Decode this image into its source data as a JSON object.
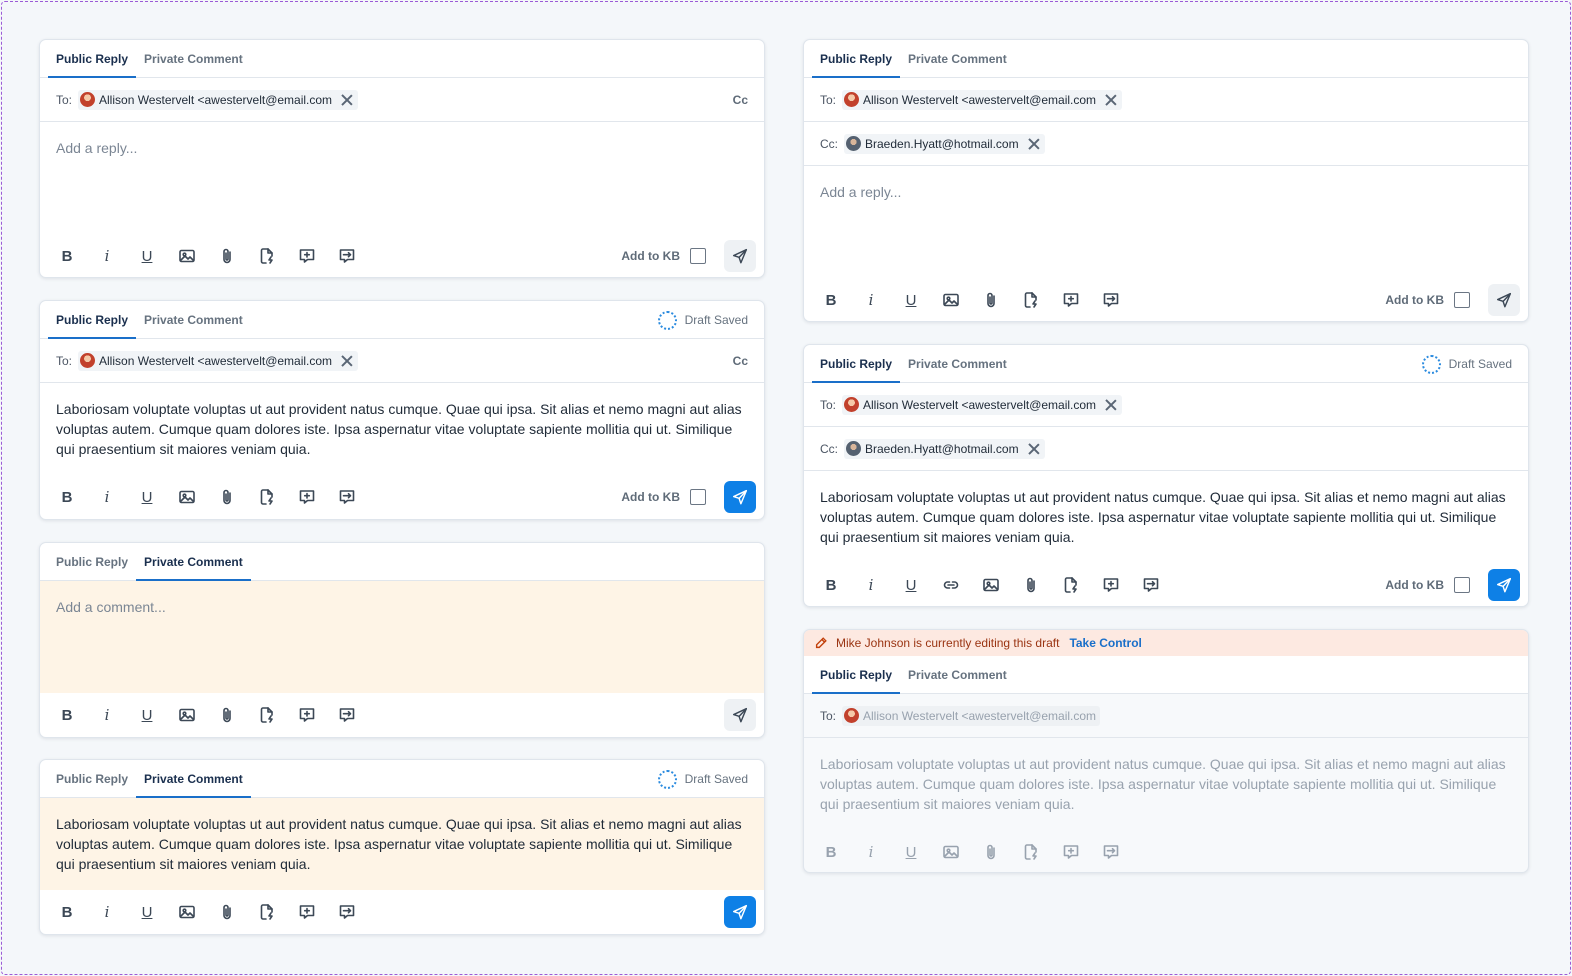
{
  "tabs": {
    "public": "Public Reply",
    "private": "Private Comment"
  },
  "draft_saved": "Draft Saved",
  "to_label": "To:",
  "cc_label": "Cc:",
  "cc_button": "Cc",
  "to_recipient": "Allison Westervelt <awestervelt@email.com",
  "cc_recipient": "Braeden.Hyatt@hotmail.com",
  "reply_placeholder": "Add a reply...",
  "comment_placeholder": "Add a comment...",
  "message_text": "Laboriosam voluptate voluptas ut aut provident natus cumque. Quae qui ipsa. Sit alias et nemo magni aut alias voluptas autem. Cumque quam dolores iste. Ipsa aspernatur vitae voluptate sapiente mollitia qui ut. Similique qui praesentium sit maiores veniam quia.",
  "add_to_kb": "Add to KB",
  "toolbar_glyphs": {
    "bold": "B",
    "italic": "i",
    "underline": "U"
  },
  "banner": {
    "text": "Mike Johnson is currently editing this draft",
    "action": "Take Control"
  },
  "colors": {
    "accent": "#0e80e6",
    "comment_bg": "#fef4e6",
    "banner_bg": "#fde9e1"
  }
}
